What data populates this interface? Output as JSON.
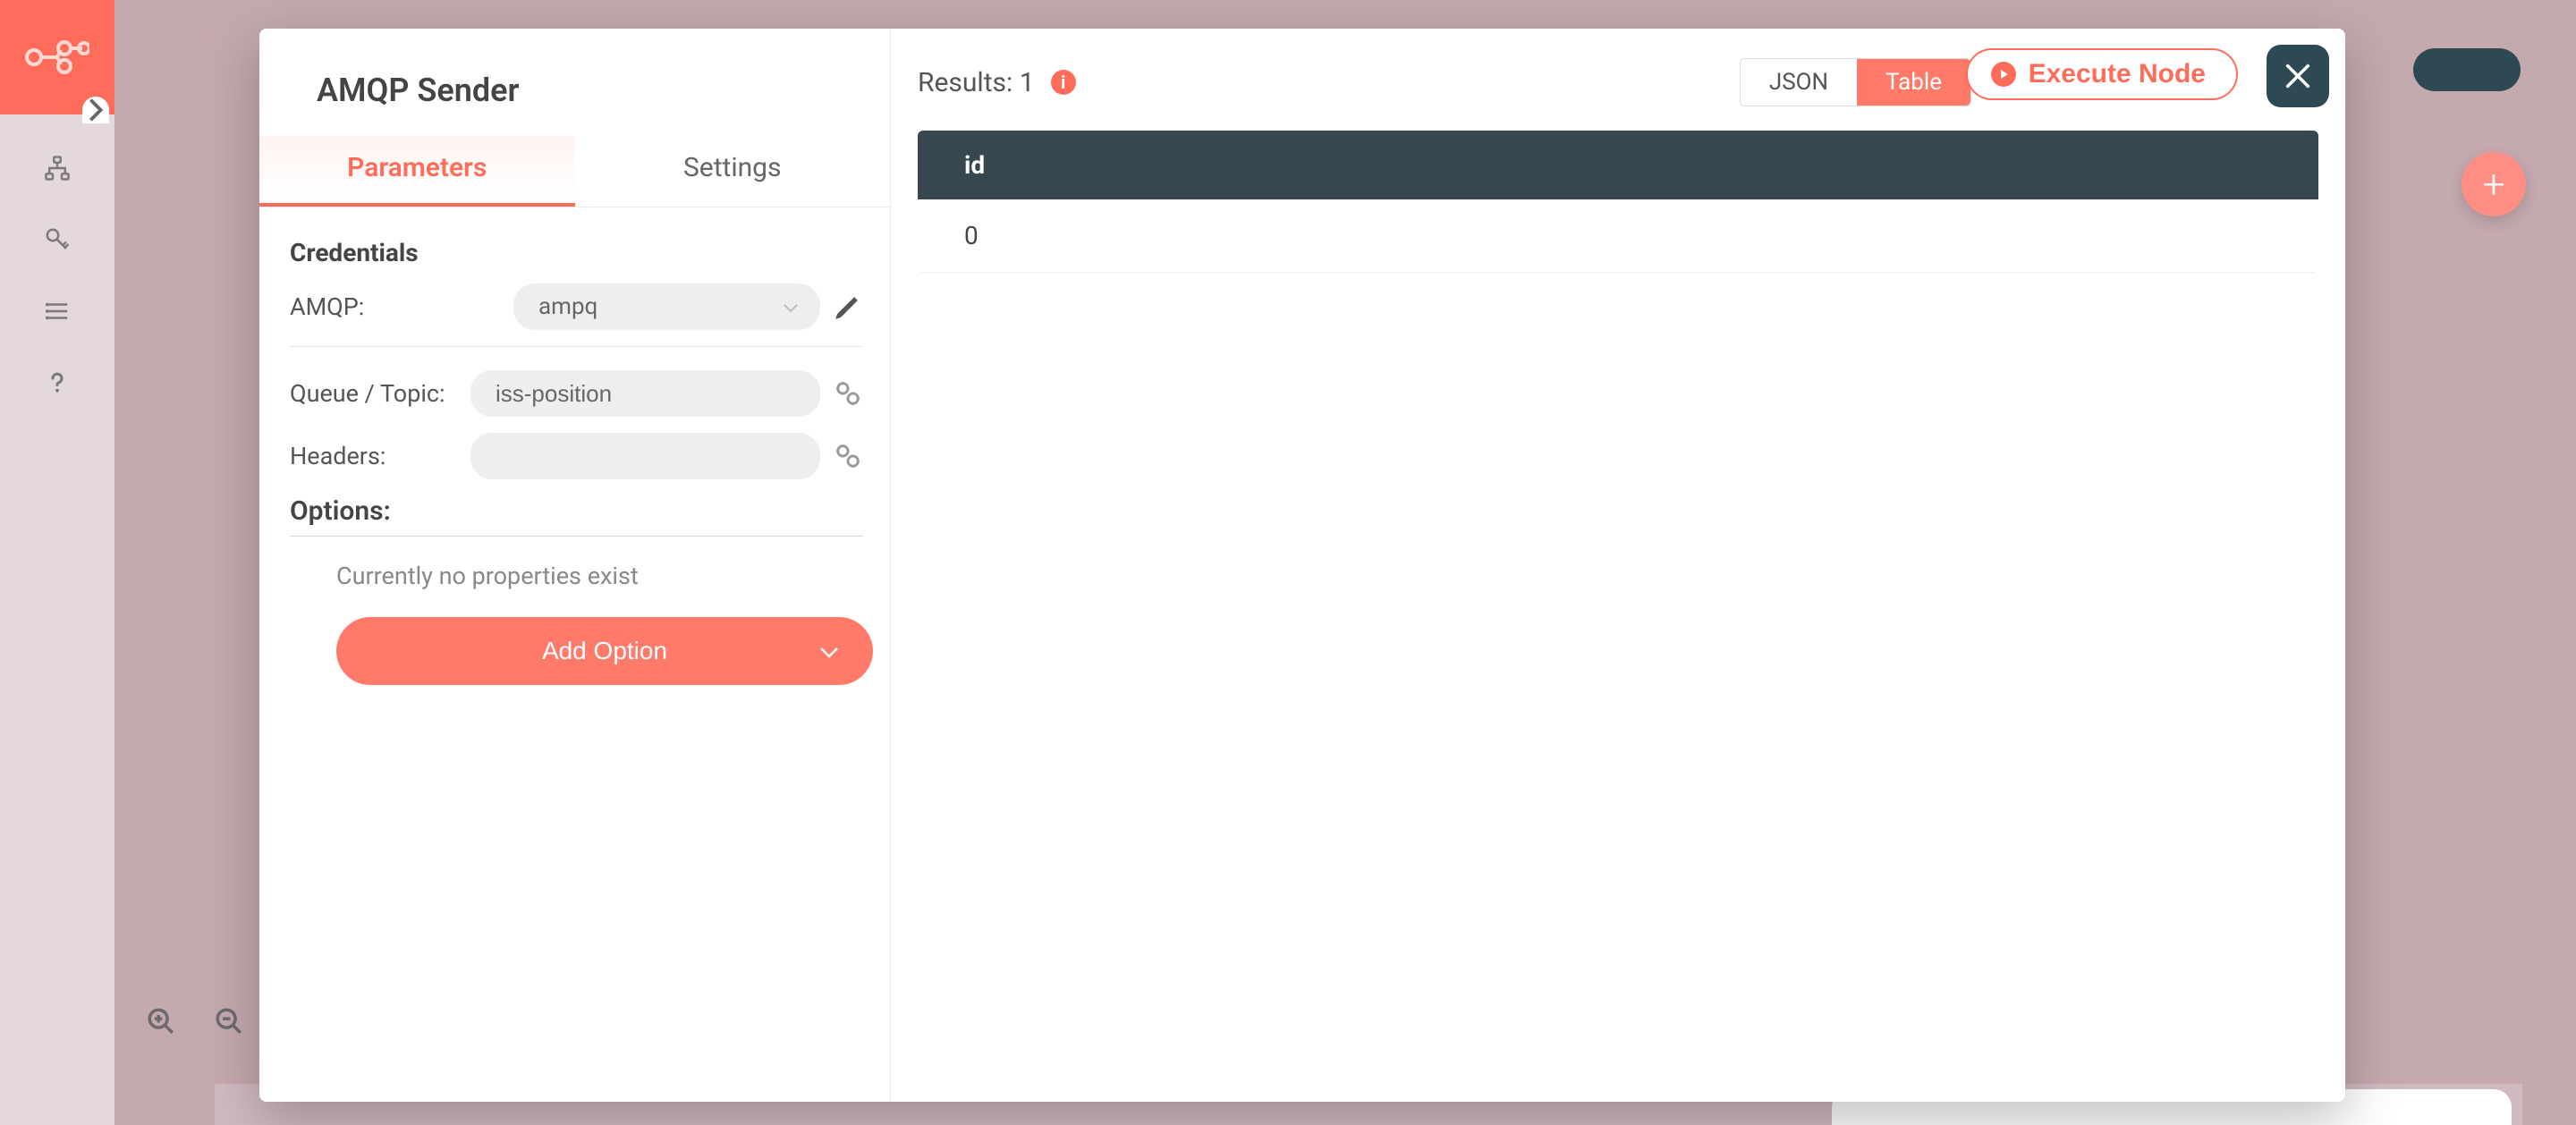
{
  "node": {
    "title": "AMQP Sender"
  },
  "tabs": {
    "parameters": "Parameters",
    "settings": "Settings"
  },
  "credentials": {
    "heading": "Credentials",
    "amqp_label": "AMQP:",
    "amqp_value": "ampq",
    "queue_label": "Queue / Topic:",
    "queue_value": "iss-position",
    "headers_label": "Headers:",
    "headers_value": ""
  },
  "options": {
    "heading": "Options:",
    "empty": "Currently no properties exist",
    "add_button": "Add Option"
  },
  "results": {
    "prefix": "Results: ",
    "count": "1",
    "toggle_json": "JSON",
    "toggle_table": "Table",
    "execute": "Execute Node",
    "header_col": "id",
    "rows": [
      "0"
    ]
  }
}
